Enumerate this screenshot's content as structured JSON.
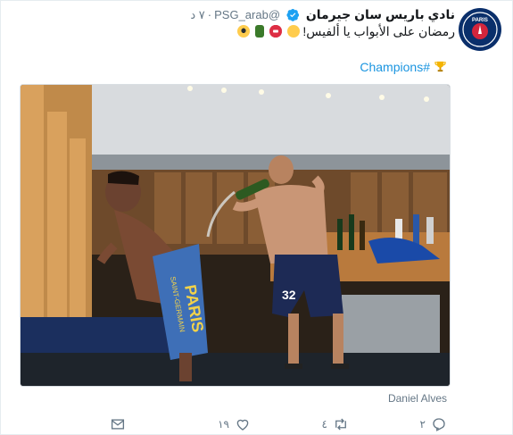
{
  "tweet": {
    "display_name": "نادي باريس سان جيرمان",
    "handle": "@PSG_arab",
    "separator": "·",
    "time": "٧ د",
    "text": "رمضان على الأبواب يا ألفيس!",
    "hashtag": "#Champions",
    "media_caption": "Daniel Alves"
  },
  "avatar": {
    "logo_text": "PARIS"
  },
  "photo": {
    "towel_text_1": "PARIS",
    "towel_text_2": "SAINT-GERMAIN",
    "shorts_number": "32"
  },
  "actions": {
    "reply_count": "٢",
    "retweet_count": "٤",
    "like_count": "١٩"
  },
  "icons": [
    "verified-icon",
    "reply-icon",
    "retweet-icon",
    "like-icon",
    "message-icon",
    "trophy-icon"
  ],
  "colors": {
    "link": "#1b95e0",
    "muted": "#657786",
    "verified": "#1da1f2",
    "psg_navy": "#0a2f6b",
    "psg_red": "#d4253c"
  }
}
